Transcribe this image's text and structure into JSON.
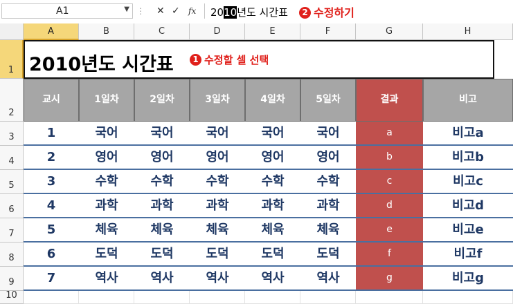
{
  "formula_bar": {
    "name_box": "A1",
    "formula_before": "20",
    "formula_selected": "10",
    "formula_after": "년도 시간표",
    "annotation_number": "2",
    "annotation_text": "수정하기",
    "cancel_icon": "✕",
    "enter_icon": "✓",
    "fx_label": "fx"
  },
  "columns": [
    "A",
    "B",
    "C",
    "D",
    "E",
    "F",
    "G",
    "H"
  ],
  "rows": [
    "1",
    "2",
    "3",
    "4",
    "5",
    "6",
    "7",
    "8",
    "9",
    "10"
  ],
  "sheet": {
    "title": "2010년도 시간표",
    "annotation_number": "1",
    "annotation_text": "수정할 셀 선택",
    "headers": [
      "교시",
      "1일차",
      "2일차",
      "3일차",
      "4일차",
      "5일차",
      "결과",
      "비고"
    ],
    "data_rows": [
      [
        "1",
        "국어",
        "국어",
        "국어",
        "국어",
        "국어",
        "a",
        "비고a"
      ],
      [
        "2",
        "영어",
        "영어",
        "영어",
        "영어",
        "영어",
        "b",
        "비고b"
      ],
      [
        "3",
        "수학",
        "수학",
        "수학",
        "수학",
        "수학",
        "c",
        "비고c"
      ],
      [
        "4",
        "과학",
        "과학",
        "과학",
        "과학",
        "과학",
        "d",
        "비고d"
      ],
      [
        "5",
        "체육",
        "체육",
        "체육",
        "체육",
        "체육",
        "e",
        "비고e"
      ],
      [
        "6",
        "도덕",
        "도덕",
        "도덕",
        "도덕",
        "도덕",
        "f",
        "비고f"
      ],
      [
        "7",
        "역사",
        "역사",
        "역사",
        "역사",
        "역사",
        "g",
        "비고g"
      ]
    ]
  },
  "colors": {
    "header_gray": "#a6a6a6",
    "result_red": "#c0504d",
    "text_navy": "#1f3864",
    "annotation_red": "#e0201b",
    "selected_header": "#f5d77a"
  }
}
